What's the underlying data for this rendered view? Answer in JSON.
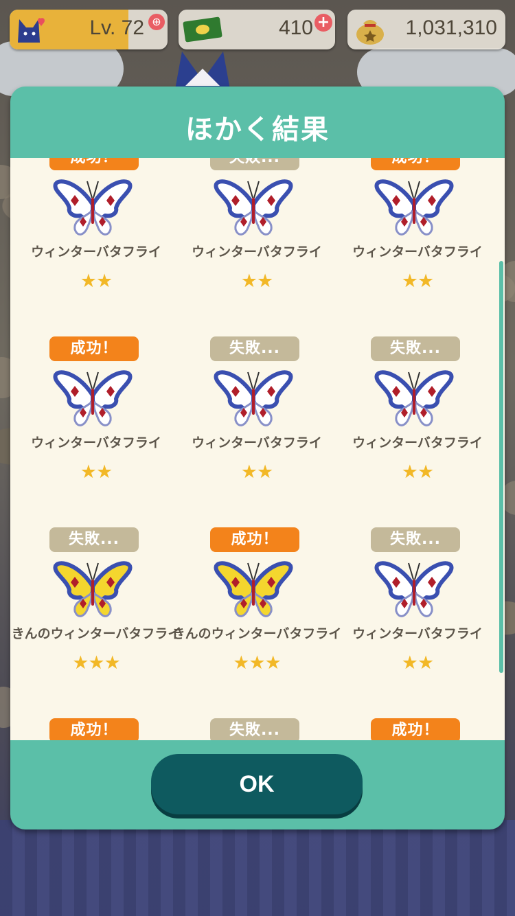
{
  "hud": {
    "level_label": "Lv. 72",
    "level_progress": 0.75,
    "tickets": "410",
    "bells": "1,031,310"
  },
  "dialog": {
    "title": "ほかく結果",
    "ok_label": "OK"
  },
  "results": [
    {
      "status": "成功！",
      "type": "success",
      "name": "ウィンターバタフライ",
      "stars": "★★",
      "color": "white"
    },
    {
      "status": "失敗...",
      "type": "fail",
      "name": "ウィンターバタフライ",
      "stars": "★★",
      "color": "white"
    },
    {
      "status": "成功！",
      "type": "success",
      "name": "ウィンターバタフライ",
      "stars": "★★",
      "color": "white"
    },
    {
      "status": "成功！",
      "type": "success",
      "name": "ウィンターバタフライ",
      "stars": "★★",
      "color": "white"
    },
    {
      "status": "失敗...",
      "type": "fail",
      "name": "ウィンターバタフライ",
      "stars": "★★",
      "color": "white"
    },
    {
      "status": "失敗...",
      "type": "fail",
      "name": "ウィンターバタフライ",
      "stars": "★★",
      "color": "white"
    },
    {
      "status": "失敗...",
      "type": "fail",
      "name": "きんのウィンターバタフライ",
      "stars": "★★★",
      "color": "gold"
    },
    {
      "status": "成功！",
      "type": "success",
      "name": "きんのウィンターバタフライ",
      "stars": "★★★",
      "color": "gold"
    },
    {
      "status": "失敗...",
      "type": "fail",
      "name": "ウィンターバタフライ",
      "stars": "★★",
      "color": "white"
    },
    {
      "status": "成功！",
      "type": "success",
      "name": "",
      "stars": "",
      "color": ""
    },
    {
      "status": "失敗...",
      "type": "fail",
      "name": "",
      "stars": "",
      "color": ""
    },
    {
      "status": "成功！",
      "type": "success",
      "name": "",
      "stars": "",
      "color": ""
    }
  ],
  "colors": {
    "dialog_teal": "#5bbfa8",
    "panel_cream": "#fbf7e9",
    "success_orange": "#f3831b",
    "fail_beige": "#c4b99a",
    "ok_button": "#0e5a5f",
    "star_gold": "#f2b827"
  },
  "icons": [
    "cat-avatar-icon",
    "zoom-icon",
    "leaf-ticket-icon",
    "plus-icon",
    "bell-bag-icon",
    "butterfly-icon"
  ]
}
